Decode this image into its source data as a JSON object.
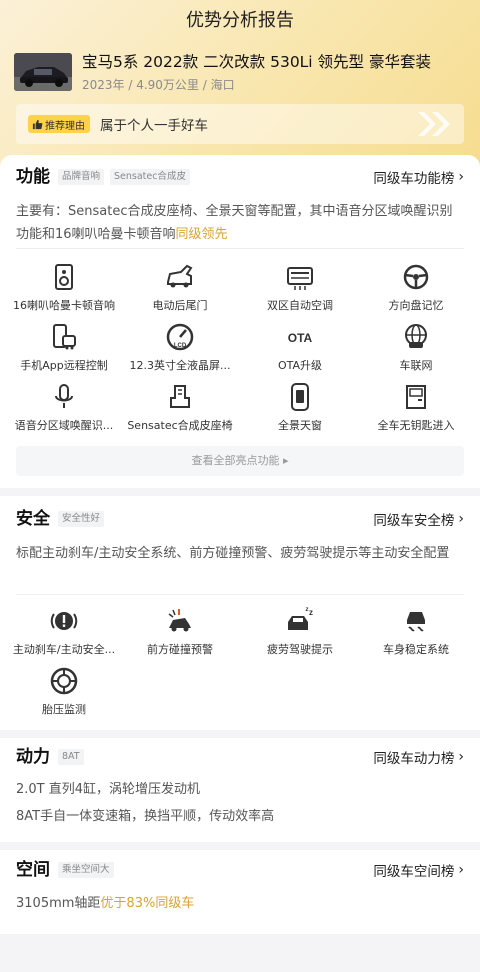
{
  "header": {
    "title": "优势分析报告"
  },
  "car": {
    "name": "宝马5系 2022款 二次改款 530Li 领先型 豪华套装",
    "meta": "2023年 / 4.90万公里 / 海口"
  },
  "reason": {
    "badge": "推荐理由",
    "text": "属于个人一手好车"
  },
  "function_section": {
    "title": "功能",
    "tags": [
      "品牌音响",
      "Sensatec合成皮"
    ],
    "rank_link": "同级车功能榜",
    "desc_main": "主要有：Sensatec合成皮座椅、全景天窗等配置，其中语音分区域唤醒识别功能和16喇叭哈曼卡顿音响",
    "desc_hl": "同级领先",
    "features": [
      {
        "icon": "speaker-icon",
        "label": "16喇叭哈曼卡顿音响"
      },
      {
        "icon": "power-tailgate-icon",
        "label": "电动后尾门"
      },
      {
        "icon": "climate-control-icon",
        "label": "双区自动空调"
      },
      {
        "icon": "steering-wheel-icon",
        "label": "方向盘记忆"
      },
      {
        "icon": "phone-remote-icon",
        "label": "手机App远程控制"
      },
      {
        "icon": "lcd-gauge-icon",
        "label": "12.3英寸全液晶屏..."
      },
      {
        "icon": "ota-icon",
        "label": "OTA升级"
      },
      {
        "icon": "globe-car-icon",
        "label": "车联网"
      },
      {
        "icon": "microphone-icon",
        "label": "语音分区域唤醒识..."
      },
      {
        "icon": "seat-icon",
        "label": "Sensatec合成皮座椅"
      },
      {
        "icon": "sunroof-icon",
        "label": "全景天窗"
      },
      {
        "icon": "keyless-door-icon",
        "label": "全车无钥匙进入"
      }
    ],
    "see_all": "查看全部亮点功能 ▸"
  },
  "safety_section": {
    "title": "安全",
    "tag": "安全性好",
    "rank_link": "同级车安全榜",
    "desc": "标配主动刹车/主动安全系统、前方碰撞预警、疲劳驾驶提示等主动安全配置",
    "features": [
      {
        "icon": "brake-warning-icon",
        "label": "主动刹车/主动安全..."
      },
      {
        "icon": "collision-warning-icon",
        "label": "前方碰撞预警"
      },
      {
        "icon": "fatigue-driving-icon",
        "label": "疲劳驾驶提示"
      },
      {
        "icon": "stability-control-icon",
        "label": "车身稳定系统"
      },
      {
        "icon": "tire-pressure-icon",
        "label": "胎压监测"
      }
    ]
  },
  "power_section": {
    "title": "动力",
    "tag": "8AT",
    "rank_link": "同级车动力榜",
    "lines": [
      "2.0T 直列4缸，涡轮增压发动机",
      "8AT手自一体变速箱，换挡平顺，传动效率高"
    ]
  },
  "space_section": {
    "title": "空间",
    "tag": "乘坐空间大",
    "rank_link": "同级车空间榜",
    "desc_main": "3105mm轴距",
    "desc_hl": "优于83%同级车"
  },
  "colors": {
    "accent": "#d9a431",
    "badge": "#ffd24a",
    "hero_bg": "#f9e6ad"
  }
}
